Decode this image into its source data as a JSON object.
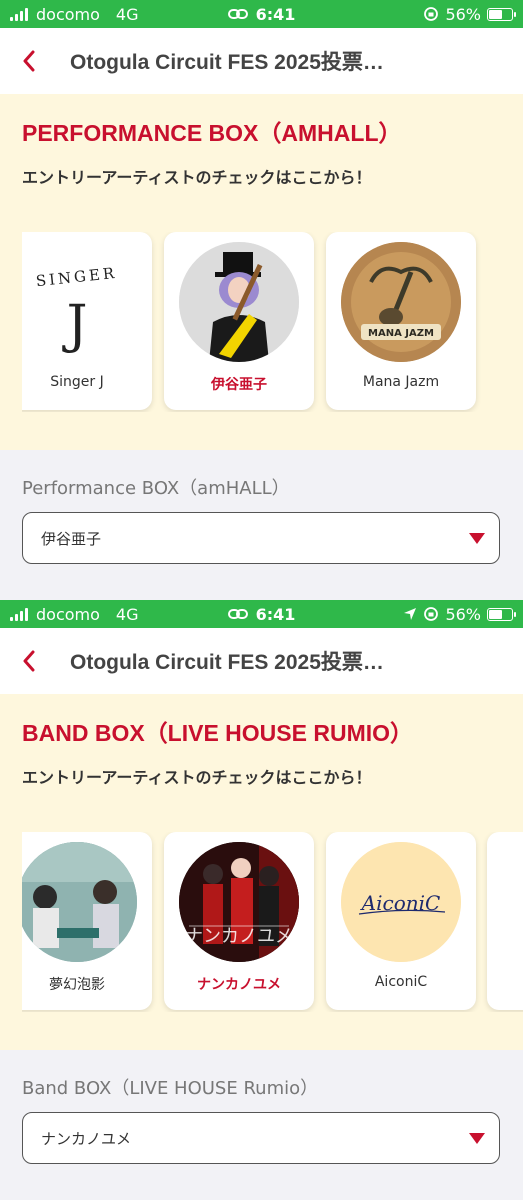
{
  "colors": {
    "status_green": "#2fb84a",
    "brand_red": "#c8102e",
    "section_bg": "#fef7dd",
    "page_bg": "#f2f2f6"
  },
  "screens": [
    {
      "status": {
        "carrier": "docomo",
        "network": "4G",
        "time": "6:41",
        "battery": "56%"
      },
      "nav": {
        "title": "Otogula Circuit FES 2025投票…"
      },
      "section": {
        "title": "PERFORMANCE BOX（AMHALL）",
        "subtitle": "エントリーアーティストのチェックはここから！",
        "cards": [
          {
            "name": "Singer J",
            "selected": false,
            "avatar_icon": "singer-j-logo"
          },
          {
            "name": "伊谷亜子",
            "selected": true,
            "avatar_icon": "guitarist-photo"
          },
          {
            "name": "Mana Jazm",
            "selected": false,
            "avatar_icon": "mana-jazm-logo"
          }
        ],
        "logo_text": {
          "singer": "SINGER",
          "j": "J",
          "mana": "MANA JAZM"
        }
      },
      "form": {
        "label": "Performance BOX（amHALL）",
        "selected_value": "伊谷亜子"
      }
    },
    {
      "status": {
        "carrier": "docomo",
        "network": "4G",
        "time": "6:41",
        "battery": "56%"
      },
      "nav": {
        "title": "Otogula Circuit FES 2025投票…"
      },
      "section": {
        "title": "BAND BOX（LIVE HOUSE RUMIO）",
        "subtitle": "エントリーアーティストのチェックはここから！",
        "cards": [
          {
            "name": "夢幻泡影",
            "selected": false,
            "avatar_icon": "band-photo"
          },
          {
            "name": "ナンカノユメ",
            "selected": true,
            "avatar_icon": "band-photo-red"
          },
          {
            "name": "AiconiC",
            "selected": false,
            "avatar_icon": "aiconic-logo"
          }
        ],
        "logo_text": {
          "aiconic": "AiconiC"
        }
      },
      "form": {
        "label": "Band BOX（LIVE HOUSE Rumio）",
        "selected_value": "ナンカノユメ"
      }
    }
  ]
}
